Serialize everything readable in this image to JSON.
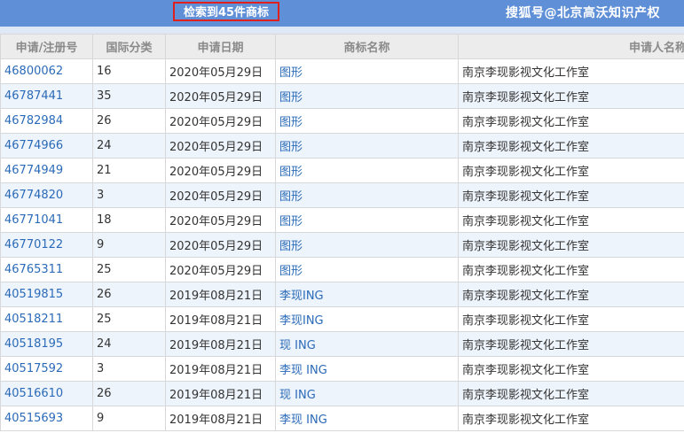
{
  "header": {
    "result_count": "检索到45件商标",
    "watermark": "搜狐号@北京高沃知识产权"
  },
  "table": {
    "columns": [
      "申请/注册号",
      "国际分类",
      "申请日期",
      "商标名称",
      "申请人名称"
    ],
    "rows": [
      {
        "reg_no": "46800062",
        "class": "16",
        "date": "2020年05月29日",
        "name": "图形",
        "applicant": "南京李现影视文化工作室"
      },
      {
        "reg_no": "46787441",
        "class": "35",
        "date": "2020年05月29日",
        "name": "图形",
        "applicant": "南京李现影视文化工作室"
      },
      {
        "reg_no": "46782984",
        "class": "26",
        "date": "2020年05月29日",
        "name": "图形",
        "applicant": "南京李现影视文化工作室"
      },
      {
        "reg_no": "46774966",
        "class": "24",
        "date": "2020年05月29日",
        "name": "图形",
        "applicant": "南京李现影视文化工作室"
      },
      {
        "reg_no": "46774949",
        "class": "21",
        "date": "2020年05月29日",
        "name": "图形",
        "applicant": "南京李现影视文化工作室"
      },
      {
        "reg_no": "46774820",
        "class": "3",
        "date": "2020年05月29日",
        "name": "图形",
        "applicant": "南京李现影视文化工作室"
      },
      {
        "reg_no": "46771041",
        "class": "18",
        "date": "2020年05月29日",
        "name": "图形",
        "applicant": "南京李现影视文化工作室"
      },
      {
        "reg_no": "46770122",
        "class": "9",
        "date": "2020年05月29日",
        "name": "图形",
        "applicant": "南京李现影视文化工作室"
      },
      {
        "reg_no": "46765311",
        "class": "25",
        "date": "2020年05月29日",
        "name": "图形",
        "applicant": "南京李现影视文化工作室"
      },
      {
        "reg_no": "40519815",
        "class": "26",
        "date": "2019年08月21日",
        "name": "李现ING",
        "applicant": "南京李现影视文化工作室"
      },
      {
        "reg_no": "40518211",
        "class": "25",
        "date": "2019年08月21日",
        "name": "李现ING",
        "applicant": "南京李现影视文化工作室"
      },
      {
        "reg_no": "40518195",
        "class": "24",
        "date": "2019年08月21日",
        "name": "现 ING",
        "applicant": "南京李现影视文化工作室"
      },
      {
        "reg_no": "40517592",
        "class": "3",
        "date": "2019年08月21日",
        "name": "李现 ING",
        "applicant": "南京李现影视文化工作室"
      },
      {
        "reg_no": "40516610",
        "class": "26",
        "date": "2019年08月21日",
        "name": "现 ING",
        "applicant": "南京李现影视文化工作室"
      },
      {
        "reg_no": "40515693",
        "class": "9",
        "date": "2019年08月21日",
        "name": "李现 ING",
        "applicant": "南京李现影视文化工作室"
      }
    ]
  },
  "colors": {
    "topbar": "#5f8fd6",
    "highlight_border": "#e0201c",
    "link": "#2a6ab8",
    "row_alt": "#eef4fb"
  }
}
